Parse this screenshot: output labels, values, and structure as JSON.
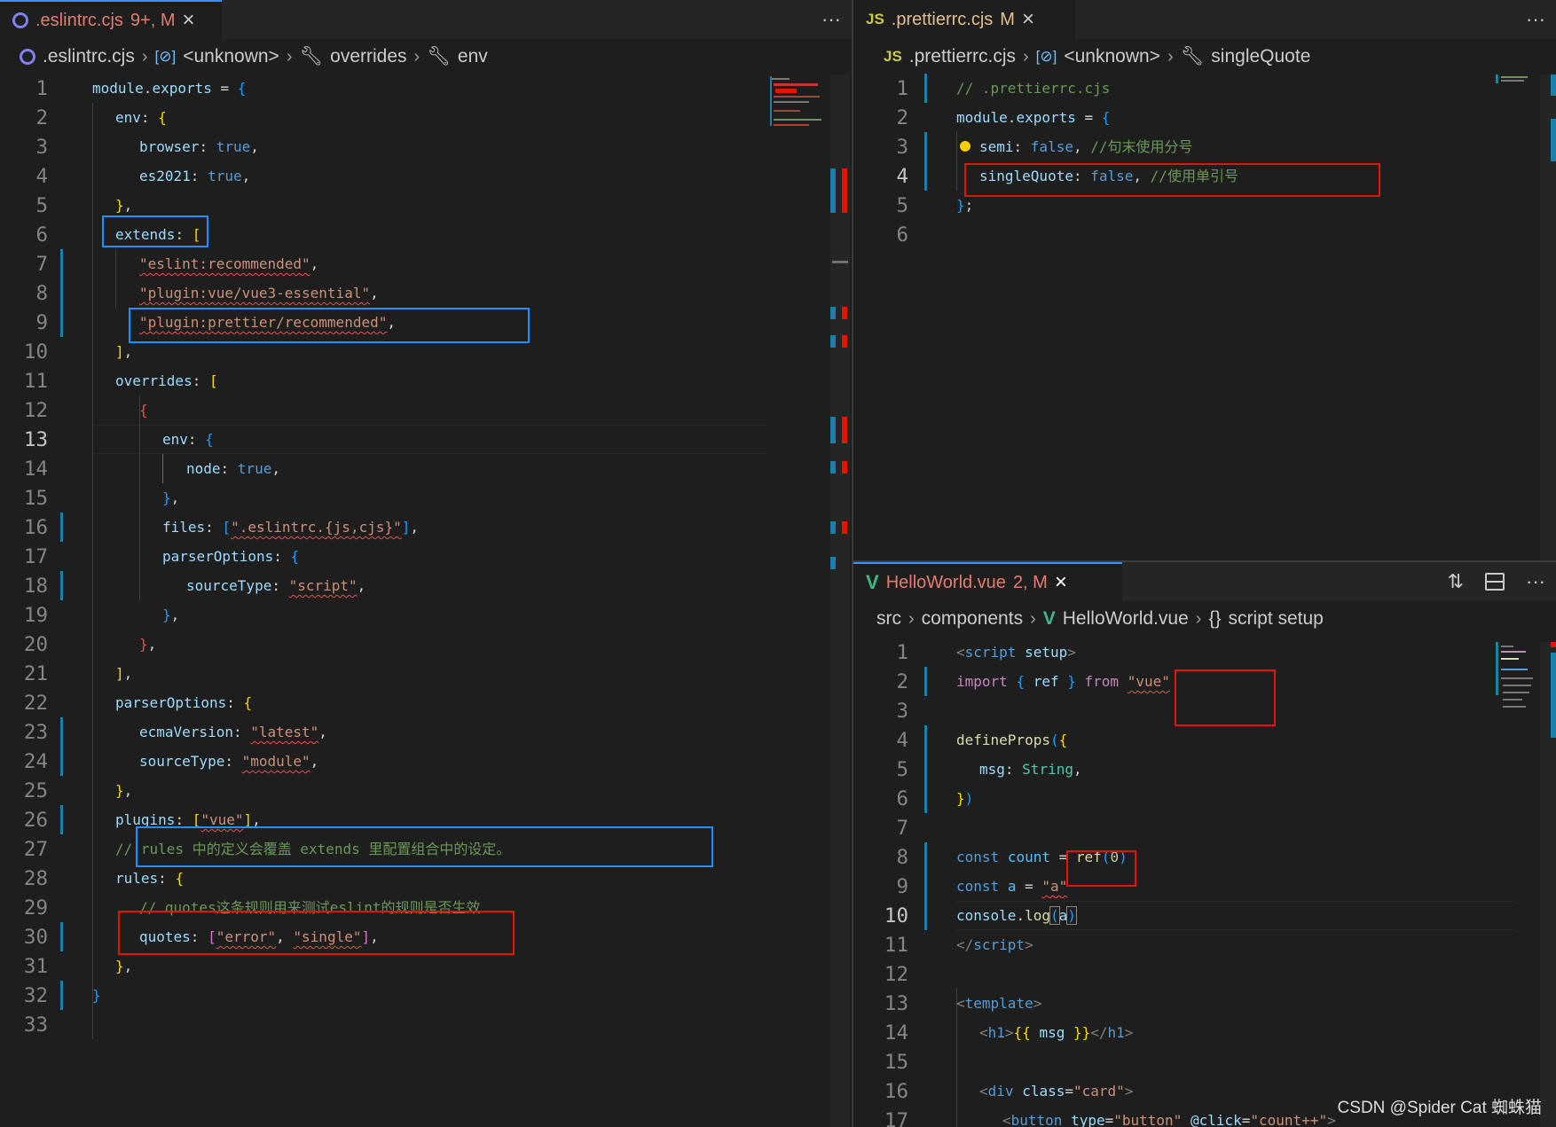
{
  "left": {
    "tab": {
      "icon": "eslint-icon",
      "label": ".eslintrc.cjs",
      "status": "9+, M",
      "close": "×"
    },
    "more": "···",
    "breadcrumb": [
      {
        "icon": "eslint-icon",
        "label": ".eslintrc.cjs"
      },
      {
        "icon": "variable-icon",
        "label": "<unknown>"
      },
      {
        "icon": "wrench-icon",
        "label": "overrides"
      },
      {
        "icon": "wrench-icon",
        "label": "env"
      }
    ],
    "lines": [
      "1",
      "2",
      "3",
      "4",
      "5",
      "6",
      "7",
      "8",
      "9",
      "10",
      "11",
      "12",
      "13",
      "14",
      "15",
      "16",
      "17",
      "18",
      "19",
      "20",
      "21",
      "22",
      "23",
      "24",
      "25",
      "26",
      "27",
      "28",
      "29",
      "30",
      "31",
      "32",
      "33"
    ],
    "current_line": "13"
  },
  "topright": {
    "tab": {
      "icon": "js-icon",
      "icon_text": "JS",
      "label": ".prettierrc.cjs",
      "status": "M",
      "close": "×"
    },
    "more": "···",
    "breadcrumb": [
      {
        "icon": "js-icon",
        "icon_text": "JS",
        "label": ".prettierrc.cjs"
      },
      {
        "icon": "variable-icon",
        "label": "<unknown>"
      },
      {
        "icon": "wrench-icon",
        "label": "singleQuote"
      }
    ],
    "lines": [
      "1",
      "2",
      "3",
      "4",
      "5",
      "6"
    ],
    "current_line": "4"
  },
  "bottomright": {
    "tab": {
      "icon": "vue-icon",
      "label": "HelloWorld.vue",
      "status": "2, M",
      "close": "×"
    },
    "actions": [
      "compare-icon",
      "split-icon",
      "more-icon"
    ],
    "more": "···",
    "breadcrumb": [
      {
        "icon": "",
        "label": "src"
      },
      {
        "icon": "",
        "label": "components"
      },
      {
        "icon": "vue-icon",
        "label": "HelloWorld.vue"
      },
      {
        "icon": "braces-icon",
        "label": "script setup"
      }
    ],
    "lines": [
      "1",
      "2",
      "3",
      "4",
      "5",
      "6",
      "7",
      "8",
      "9",
      "10",
      "11",
      "12",
      "13",
      "14",
      "15",
      "16",
      "17"
    ],
    "current_line": "10"
  },
  "code": {
    "l1": [
      "module",
      ".",
      "exports",
      " = ",
      "{"
    ],
    "l2": [
      "env",
      ": ",
      "{"
    ],
    "l3": [
      "browser",
      ": ",
      "true",
      ","
    ],
    "l4": [
      "es2021",
      ": ",
      "true",
      ","
    ],
    "l5": [
      "}",
      ","
    ],
    "l6": [
      "extends",
      ": ",
      "["
    ],
    "l7": [
      "\"eslint:recommended\"",
      ","
    ],
    "l8": [
      "\"plugin:vue/vue3-essential\"",
      ","
    ],
    "l9": [
      "\"plugin:prettier/recommended\"",
      ","
    ],
    "l10": [
      "]",
      ","
    ],
    "l11": [
      "overrides",
      ": ",
      "["
    ],
    "l12": [
      "{"
    ],
    "l13": [
      "env",
      ": ",
      "{"
    ],
    "l14": [
      "node",
      ": ",
      "true",
      ","
    ],
    "l15": [
      "}",
      ","
    ],
    "l16": [
      "files",
      ": ",
      "[",
      "\".eslintrc.{js,cjs}\"",
      "]",
      ","
    ],
    "l17": [
      "parserOptions",
      ": ",
      "{"
    ],
    "l18": [
      "sourceType",
      ": ",
      "\"script\"",
      ","
    ],
    "l19": [
      "}",
      ","
    ],
    "l20": [
      "}",
      ","
    ],
    "l21": [
      "]",
      ","
    ],
    "l22": [
      "parserOptions",
      ": ",
      "{"
    ],
    "l23": [
      "ecmaVersion",
      ": ",
      "\"latest\"",
      ","
    ],
    "l24": [
      "sourceType",
      ": ",
      "\"module\"",
      ","
    ],
    "l25": [
      "}",
      ","
    ],
    "l26": [
      "plugins",
      ": ",
      "[",
      "\"vue\"",
      "]",
      ","
    ],
    "l27": [
      "// rules 中的定义会覆盖 extends 里配置组合中的设定。"
    ],
    "l28": [
      "rules",
      ": ",
      "{"
    ],
    "l29": [
      "// quotes这条规则用来测试eslint的规则是否生效"
    ],
    "l30": [
      "quotes",
      ": ",
      "[",
      "\"error\"",
      ", ",
      "\"single\"",
      "]",
      ","
    ],
    "l31": [
      "}",
      ","
    ],
    "l32": [
      "}"
    ],
    "p1": [
      "// .prettierrc.cjs"
    ],
    "p2": [
      "module",
      ".",
      "exports",
      " = ",
      "{"
    ],
    "p3": [
      "semi",
      ": ",
      "false",
      ", ",
      "//句末使用分号"
    ],
    "p4": [
      "singleQuote",
      ": ",
      "false",
      ", ",
      "//使用单引号"
    ],
    "p5": [
      "}",
      ";"
    ],
    "v1": [
      "<",
      "script",
      " ",
      "setup",
      ">"
    ],
    "v2": [
      "import",
      " ",
      "{",
      " ref ",
      "}",
      " ",
      "from",
      " ",
      "\"vue\""
    ],
    "v4": [
      "defineProps",
      "(",
      "{"
    ],
    "v5": [
      "msg",
      ": ",
      "String",
      ","
    ],
    "v6": [
      "}",
      ")"
    ],
    "v8": [
      "const",
      " ",
      "count",
      " = ",
      "ref",
      "(",
      "0",
      ")"
    ],
    "v9": [
      "const",
      " ",
      "a",
      " = ",
      "\"a\""
    ],
    "v10": [
      "console",
      ".",
      "log",
      "(",
      "a",
      ")"
    ],
    "v11": [
      "</",
      "script",
      ">"
    ],
    "v13": [
      "<",
      "template",
      ">"
    ],
    "v14": [
      "<",
      "h1",
      ">",
      "{{",
      " msg ",
      "}}",
      "</",
      "h1",
      ">"
    ],
    "v16": [
      "<",
      "div",
      " ",
      "class",
      "=",
      "\"card\"",
      ">"
    ],
    "v17": [
      "<",
      "button",
      " ",
      "type",
      "=",
      "\"button\"",
      " ",
      "@click",
      "=",
      "\"count++\"",
      ">"
    ]
  },
  "watermark": "CSDN @Spider Cat 蜘蛛猫",
  "colors": {
    "accent_red": "#e51400",
    "accent_blue": "#1e90ff",
    "vue_green": "#41b883",
    "js_yellow": "#cbcb41"
  }
}
